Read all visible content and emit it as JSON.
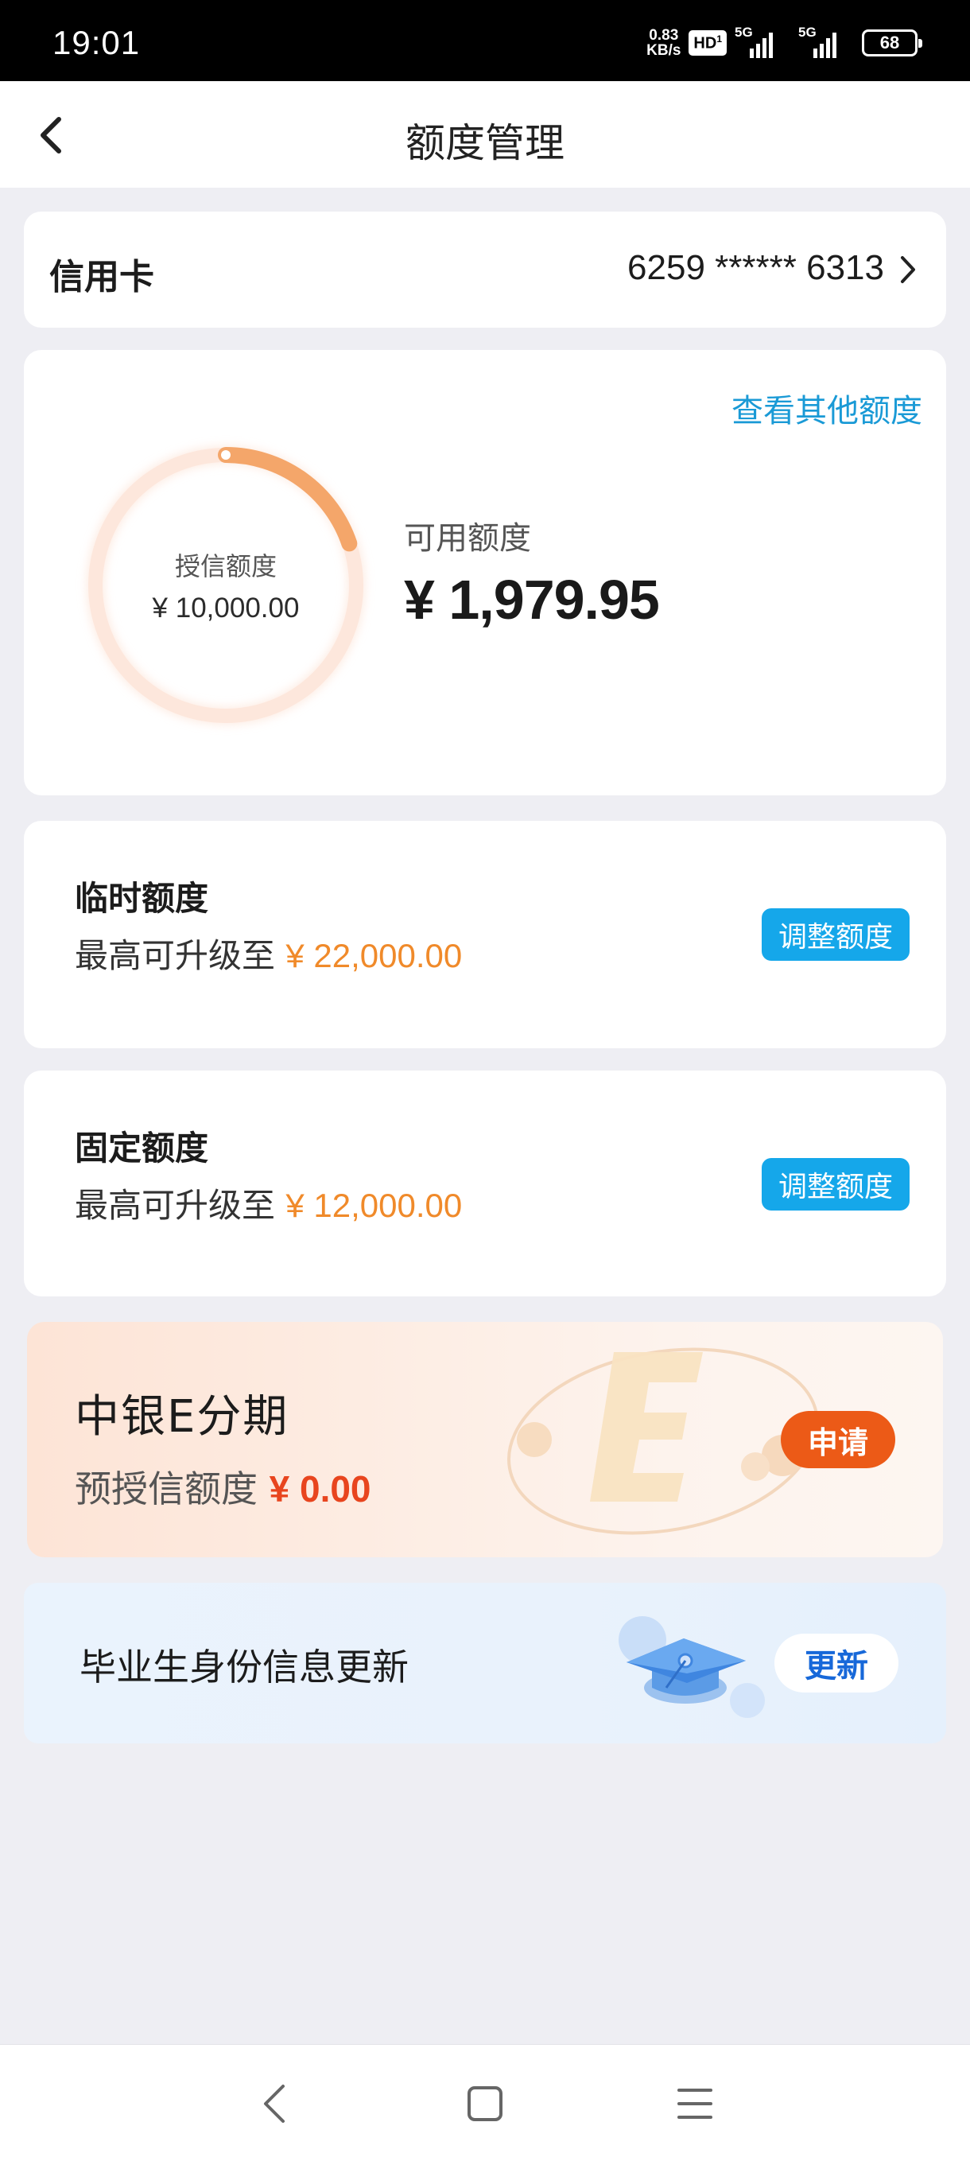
{
  "status_bar": {
    "time": "19:01",
    "net_speed_value": "0.83",
    "net_speed_unit": "KB/s",
    "hd_label": "HD",
    "signal1_label": "5G",
    "signal2_label": "5G",
    "battery": "68"
  },
  "header": {
    "title": "额度管理",
    "back_icon": "chevron-left-icon"
  },
  "card_selector": {
    "label": "信用卡",
    "number": "6259 ****** 6313",
    "chevron_icon": "chevron-right-icon"
  },
  "limit_overview": {
    "other_limits_link": "查看其他额度",
    "credit_limit_label": "授信额度",
    "credit_limit_value": "¥ 10,000.00",
    "available_label": "可用额度",
    "available_value": "¥ 1,979.95",
    "available_fraction": 0.197995,
    "ring_color": "#f4a66a",
    "ring_track_color": "#fde7dc"
  },
  "temporary_limit": {
    "title": "临时额度",
    "desc_prefix": "最高可升级至",
    "amount": "¥ 22,000.00",
    "button": "调整额度"
  },
  "fixed_limit": {
    "title": "固定额度",
    "desc_prefix": "最高可升级至",
    "amount": "¥ 12,000.00",
    "button": "调整额度"
  },
  "installment": {
    "title": "中银E分期",
    "desc_prefix": "预授信额度",
    "amount": "¥ 0.00",
    "button": "申请",
    "deco_icon": "e-letter-icon"
  },
  "graduate_update": {
    "text": "毕业生身份信息更新",
    "button": "更新",
    "icon": "graduation-cap-icon"
  },
  "system_nav": {
    "back_icon": "back-icon",
    "home_icon": "home-icon",
    "menu_icon": "menu-icon"
  },
  "colors": {
    "accent_blue": "#15a7ea",
    "link_blue": "#1a9ad6",
    "amount_orange": "#f08a2a",
    "apply_orange": "#ec5a17",
    "update_blue": "#1768d9"
  }
}
